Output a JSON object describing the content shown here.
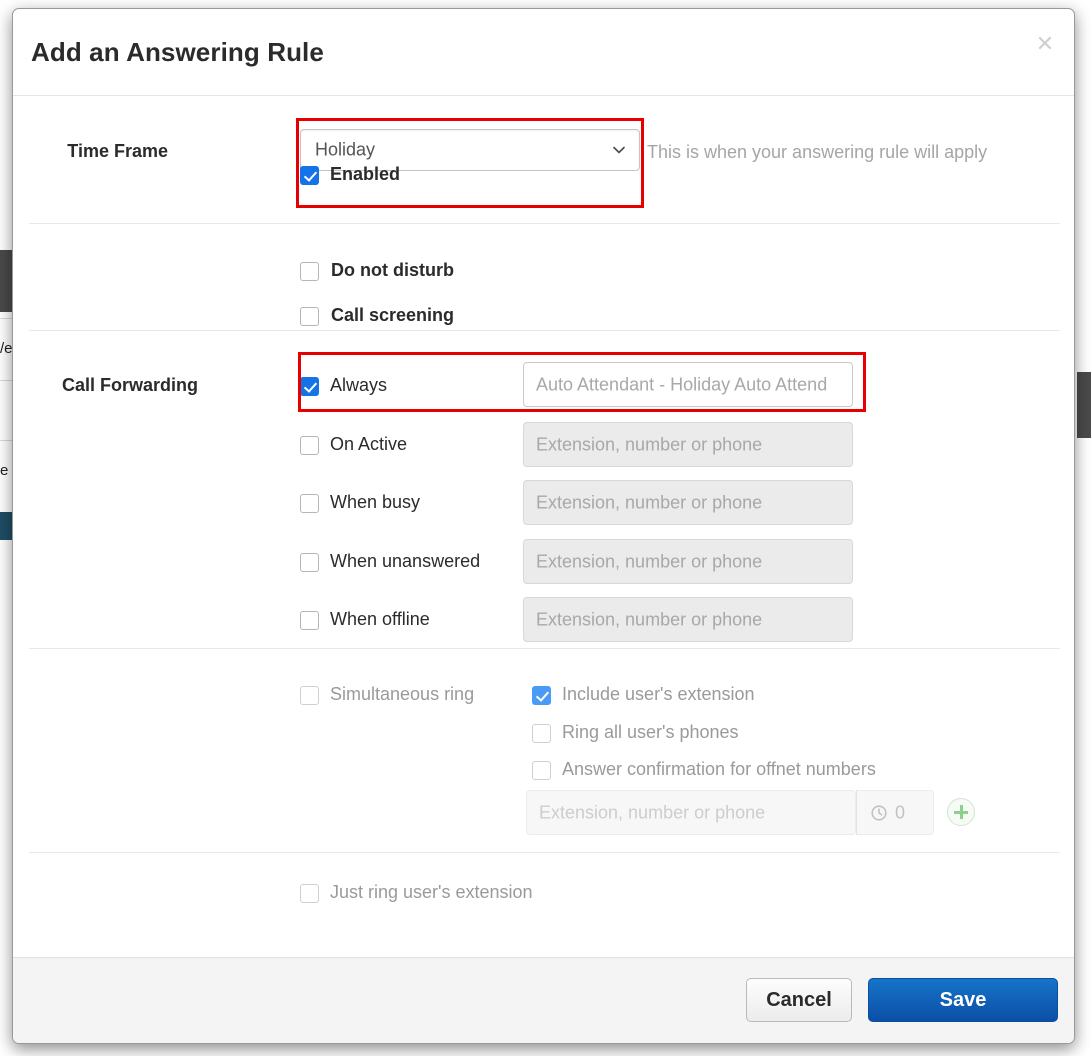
{
  "modal": {
    "title": "Add an Answering Rule",
    "close_icon": "close-icon"
  },
  "time_frame": {
    "label": "Time Frame",
    "selected": "Holiday",
    "chevron_icon": "chevron-down-icon",
    "helper": "This is when your answering rule will apply",
    "enabled_label": "Enabled",
    "enabled_checked": true
  },
  "options": {
    "do_not_disturb": {
      "label": "Do not disturb",
      "checked": false
    },
    "call_screening": {
      "label": "Call screening",
      "checked": false
    }
  },
  "call_forwarding": {
    "label": "Call Forwarding",
    "placeholder": "Extension, number or phone",
    "rows": [
      {
        "label": "Always",
        "checked": true,
        "value": "Auto Attendant - Holiday Auto Attend"
      },
      {
        "label": "On Active",
        "checked": false,
        "value": ""
      },
      {
        "label": "When busy",
        "checked": false,
        "value": ""
      },
      {
        "label": "When unanswered",
        "checked": false,
        "value": ""
      },
      {
        "label": "When offline",
        "checked": false,
        "value": ""
      }
    ]
  },
  "simultaneous_ring": {
    "label": "Simultaneous ring",
    "checked": false,
    "include_extension": {
      "label": "Include user's extension",
      "checked": true
    },
    "ring_all_phones": {
      "label": "Ring all user's phones",
      "checked": false
    },
    "answer_confirmation": {
      "label": "Answer confirmation for offnet numbers",
      "checked": false
    },
    "extension_placeholder": "Extension, number or phone",
    "timer_value": "0",
    "timer_icon": "clock-icon",
    "add_icon": "plus-circle-icon"
  },
  "just_ring": {
    "label": "Just ring user's extension",
    "checked": false
  },
  "footer": {
    "cancel_label": "Cancel",
    "save_label": "Save"
  },
  "colors": {
    "accent_blue": "#1473e6",
    "save_blue": "#0b4fa6",
    "highlight_red": "#e60000",
    "muted_grey": "#a5a5a5"
  }
}
